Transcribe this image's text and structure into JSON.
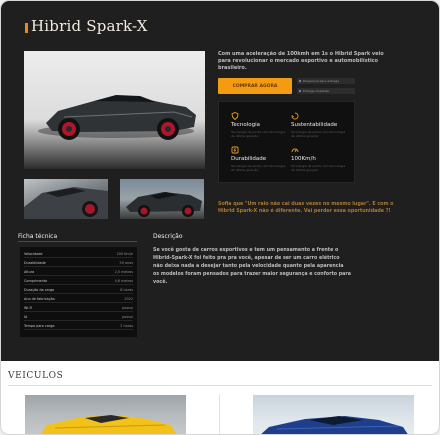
{
  "product": {
    "title": "Hibrid Spark-X",
    "intro": "Com uma aceleração de 100kmh em 1s o Hibrid Spark veio para revolucionar o mercado esportivo e automobilístico brasileiro.",
    "cta_label": "COMPRAR AGORA",
    "mini_buttons": [
      "Disponível para entrega",
      "Entrega imediata"
    ],
    "features": [
      {
        "icon": "shield-icon",
        "label": "Tecnologia",
        "desc": "Tecnologia de ponta com tecnologia de última geração"
      },
      {
        "icon": "leaf-icon",
        "label": "Sustentabilidade",
        "desc": "Tecnologia de ponta com tecnologia de última geração"
      },
      {
        "icon": "bolt-icon",
        "label": "Durabilidade",
        "desc": "Tecnologia de ponta com tecnologia de última geração"
      },
      {
        "icon": "speedometer-icon",
        "label": "100Km/h",
        "desc": "Tecnologia de ponta com tecnologia de última geração"
      }
    ],
    "quote": "Sofia que  \"Um raio não cai duas vezes no mesmo lugar\". E com o Hibrid Spark-X não é diferente. Vai perder essa oportunidade ?!"
  },
  "spec": {
    "heading": "Ficha técnica",
    "rows": [
      {
        "k": "Velocidade",
        "v": "200 Km/h"
      },
      {
        "k": "Durabilidade",
        "v": "50 anos"
      },
      {
        "k": "Altura",
        "v": "2,5 metros"
      },
      {
        "k": "Comprimento",
        "v": "4,6 metros"
      },
      {
        "k": "Duração da carga",
        "v": "8 horas"
      },
      {
        "k": "Ano de fabricação",
        "v": "2022"
      },
      {
        "k": "Wi-Fi",
        "v": "possui"
      },
      {
        "k": "IA",
        "v": "possui"
      },
      {
        "k": "Tempo para carga",
        "v": "2 horas"
      }
    ]
  },
  "description": {
    "heading": "Descrição",
    "text": "Se você gosta de carros esportivos e tem um pensamento a frente o Hibrid-Spark-X foi feito pra pra você, apesar de ser um carro elétrico não deixa nada a desejar tanto pela velocidade quanto pela aparencia os modelos foram pensados para trazer maior segurança e conforto para você."
  },
  "vehicles": {
    "heading": "VEICULOS"
  },
  "colors": {
    "accent": "#f39c12",
    "background_dark": "#1f1f1f"
  }
}
